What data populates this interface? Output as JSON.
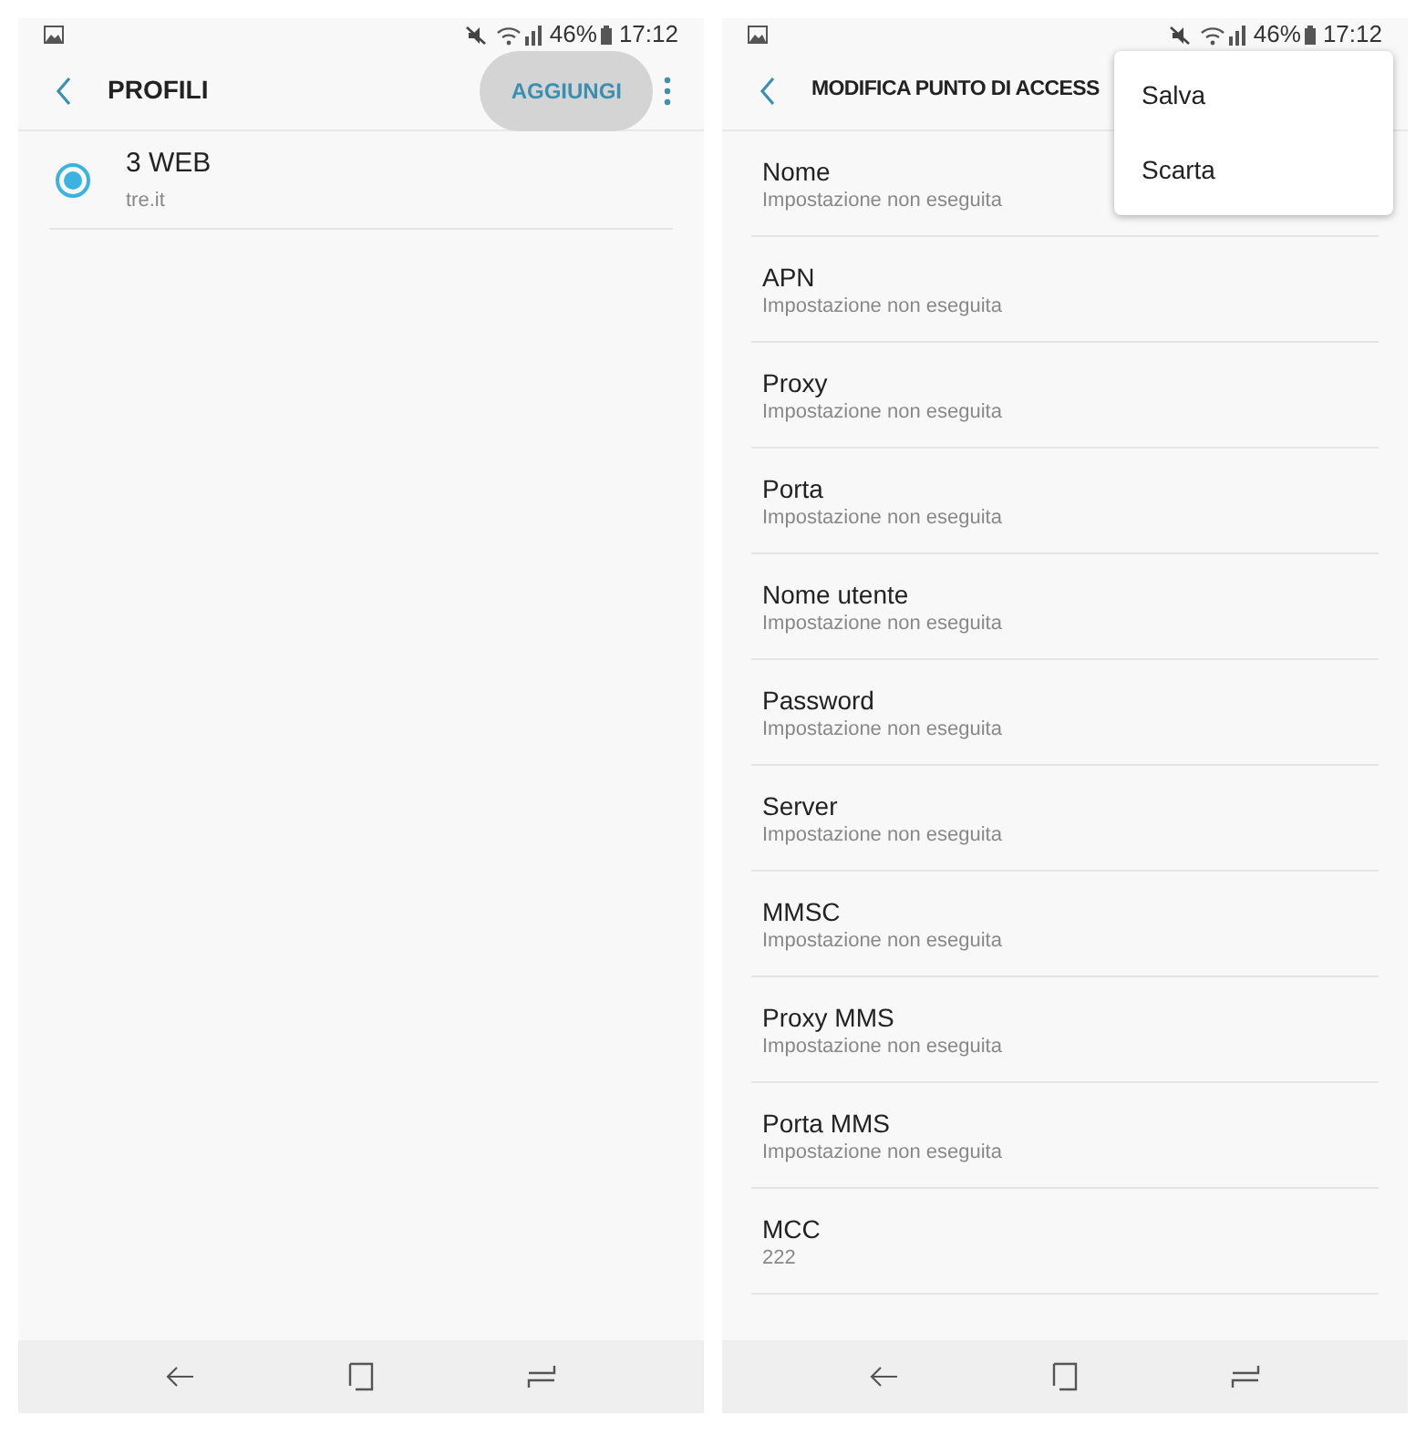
{
  "screens": [
    {
      "kind": "profiles",
      "status_bar": {
        "battery": "46%",
        "time": "17:12"
      },
      "title": "PROFILI",
      "action": {
        "label": "AGGIUNGI",
        "pressed": true
      },
      "profiles": [
        {
          "name": "3 WEB",
          "apn": "tre.it",
          "selected": true
        }
      ]
    },
    {
      "kind": "edit",
      "status_bar": {
        "battery": "46%",
        "time": "17:12"
      },
      "title": "MODIFICA PUNTO DI ACCESS",
      "menu": [
        "Salva",
        "Scarta"
      ],
      "fields": [
        {
          "label": "Nome",
          "value": "Impostazione non eseguita"
        },
        {
          "label": "APN",
          "value": "Impostazione non eseguita"
        },
        {
          "label": "Proxy",
          "value": "Impostazione non eseguita"
        },
        {
          "label": "Porta",
          "value": "Impostazione non eseguita"
        },
        {
          "label": "Nome utente",
          "value": "Impostazione non eseguita"
        },
        {
          "label": "Password",
          "value": "Impostazione non eseguita"
        },
        {
          "label": "Server",
          "value": "Impostazione non eseguita"
        },
        {
          "label": "MMSC",
          "value": "Impostazione non eseguita"
        },
        {
          "label": "Proxy MMS",
          "value": "Impostazione non eseguita"
        },
        {
          "label": "Porta MMS",
          "value": "Impostazione non eseguita"
        },
        {
          "label": "MCC",
          "value": "222"
        }
      ]
    }
  ]
}
